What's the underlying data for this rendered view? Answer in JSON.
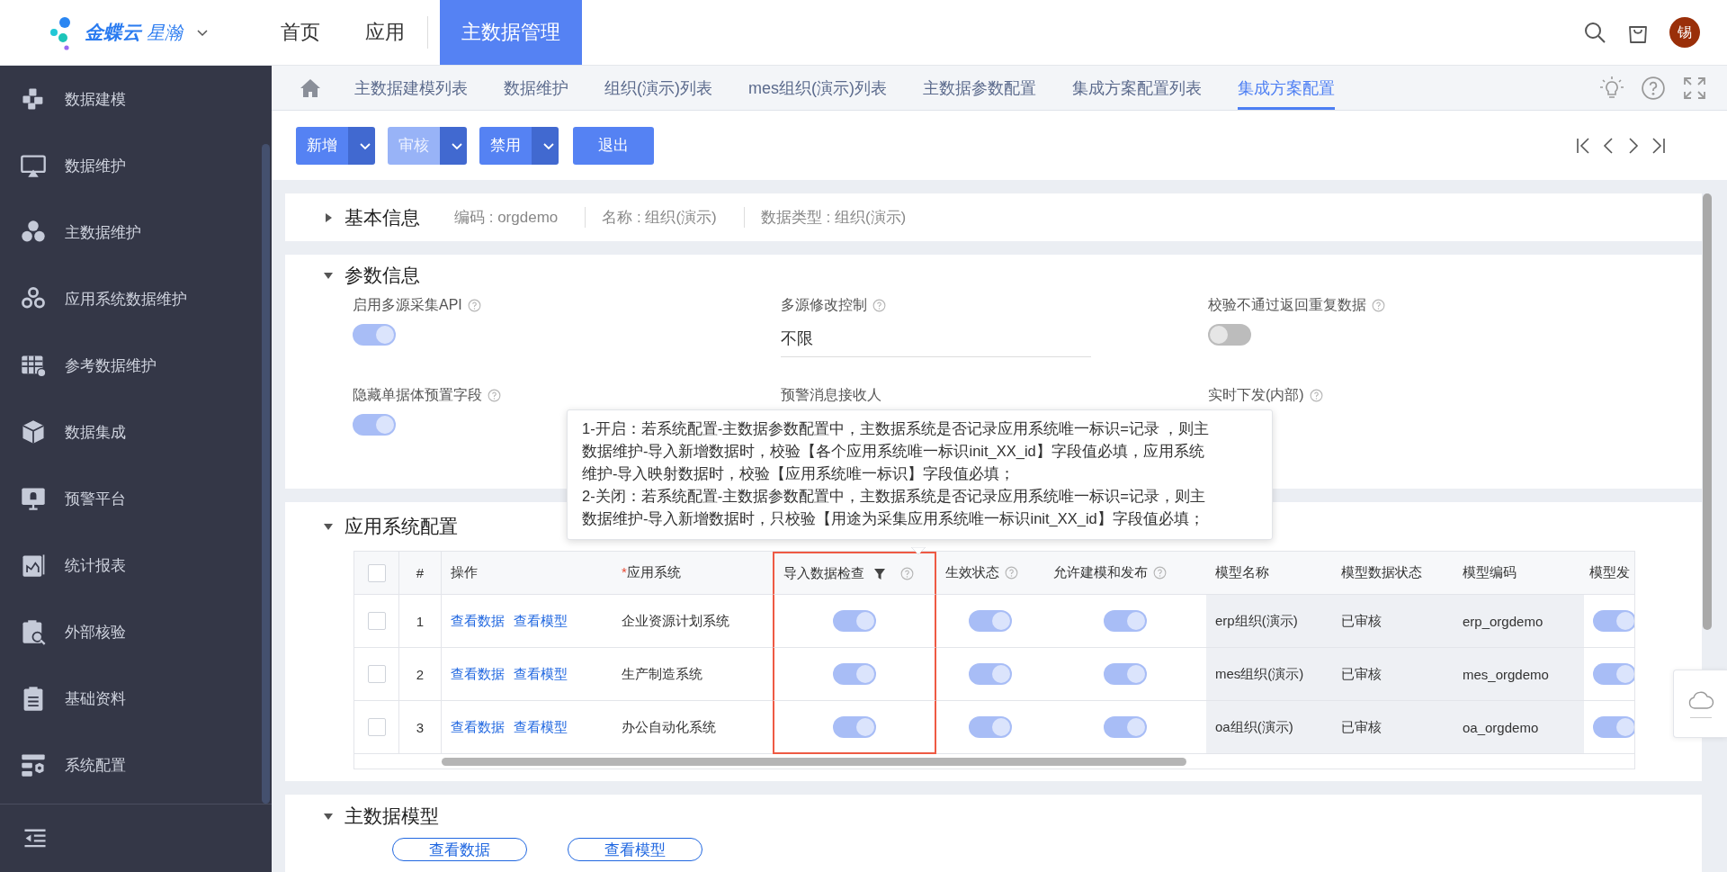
{
  "header": {
    "logo": {
      "brand": "金蝶云",
      "product": "星瀚"
    },
    "nav": [
      {
        "label": "首页",
        "selected": false
      },
      {
        "label": "应用",
        "selected": false
      },
      {
        "label": "主数据管理",
        "selected": true
      }
    ],
    "avatar": "锡"
  },
  "sidebar": {
    "items": [
      {
        "label": "数据建模"
      },
      {
        "label": "数据维护"
      },
      {
        "label": "主数据维护"
      },
      {
        "label": "应用系统数据维护"
      },
      {
        "label": "参考数据维护"
      },
      {
        "label": "数据集成"
      },
      {
        "label": "预警平台"
      },
      {
        "label": "统计报表"
      },
      {
        "label": "外部核验"
      },
      {
        "label": "基础资料"
      },
      {
        "label": "系统配置"
      }
    ]
  },
  "tabs": [
    {
      "label": "主数据建模列表",
      "selected": false
    },
    {
      "label": "数据维护",
      "selected": false
    },
    {
      "label": "组织(演示)列表",
      "selected": false
    },
    {
      "label": "mes组织(演示)列表",
      "selected": false
    },
    {
      "label": "主数据参数配置",
      "selected": false
    },
    {
      "label": "集成方案配置列表",
      "selected": false
    },
    {
      "label": "集成方案配置",
      "selected": true
    }
  ],
  "toolbar": {
    "buttons": [
      {
        "label": "新增",
        "kind": "split",
        "disabled": false
      },
      {
        "label": "审核",
        "kind": "split",
        "disabled": true
      },
      {
        "label": "禁用",
        "kind": "split",
        "disabled": false
      },
      {
        "label": "退出",
        "kind": "plain",
        "disabled": false
      }
    ]
  },
  "basic_info": {
    "title": "基本信息",
    "expanded": false,
    "fields": [
      "编码 : orgdemo",
      "名称 : 组织(演示)",
      "数据类型 : 组织(演示)"
    ]
  },
  "params": {
    "title": "参数信息",
    "expanded": true,
    "fields": [
      {
        "label": "启用多源采集API",
        "help": true,
        "kind": "toggle",
        "on": true
      },
      {
        "label": "多源修改控制",
        "help": true,
        "kind": "select",
        "value": "不限"
      },
      {
        "label": "校验不通过返回重复数据",
        "help": true,
        "kind": "toggle",
        "on": false
      },
      {
        "label": "隐藏单据体预置字段",
        "help": true,
        "kind": "toggle",
        "on": true
      },
      {
        "label": "预警消息接收人",
        "help": false,
        "kind": "covered"
      },
      {
        "label": "实时下发(内部)",
        "help": true,
        "kind": "covered"
      }
    ]
  },
  "tooltip": {
    "paragraphs": [
      "1-开启：若系统配置-主数据参数配置中，主数据系统是否记录应用系统唯一标识=记录 ，则主数据维护-导入新增数据时，校验【各个应用系统唯一标识init_XX_id】字段值必填，应用系统维护-导入映射数据时，校验【应用系统唯一标识】字段值必填；",
      "2-关闭：若系统配置-主数据参数配置中，主数据系统是否记录应用系统唯一标识=记录，则主数据维护-导入新增数据时，只校验【用途为采集应用系统唯一标识init_XX_id】字段值必填；"
    ]
  },
  "app_systems": {
    "title": "应用系统配置",
    "expanded": true,
    "select_all_checked": false,
    "columns": [
      {
        "label": "#",
        "filter": false,
        "help": false,
        "highlighted": false
      },
      {
        "label": "操作",
        "filter": false,
        "help": false,
        "highlighted": false
      },
      {
        "label": "应用系统",
        "marker": "*",
        "filter": false,
        "help": false,
        "highlighted": false
      },
      {
        "label": "导入数据检查",
        "filter": true,
        "help": true,
        "highlighted": true
      },
      {
        "label": "生效状态",
        "filter": false,
        "help": true,
        "highlighted": false
      },
      {
        "label": "允许建模和发布",
        "filter": false,
        "help": true,
        "highlighted": false
      },
      {
        "label": "模型名称",
        "filter": false,
        "help": false,
        "highlighted": false
      },
      {
        "label": "模型数据状态",
        "filter": false,
        "help": false,
        "highlighted": false
      },
      {
        "label": "模型编码",
        "filter": false,
        "help": false,
        "highlighted": false
      },
      {
        "label": "模型发",
        "filter": false,
        "help": false,
        "highlighted": false
      }
    ],
    "rows": [
      {
        "checked": false,
        "index": "1",
        "actions": [
          "查看数据",
          "查看模型"
        ],
        "system": "企业资源计划系统",
        "import_check": true,
        "effective": true,
        "allow_model": true,
        "model_name": "erp组织(演示)",
        "model_status": "已审核",
        "model_code": "erp_orgdemo",
        "column_11": true
      },
      {
        "checked": false,
        "index": "2",
        "actions": [
          "查看数据",
          "查看模型"
        ],
        "system": "生产制造系统",
        "import_check": true,
        "effective": true,
        "allow_model": true,
        "model_name": "mes组织(演示)",
        "model_status": "已审核",
        "model_code": "mes_orgdemo",
        "column_11": true
      },
      {
        "checked": false,
        "index": "3",
        "actions": [
          "查看数据",
          "查看模型"
        ],
        "system": "办公自动化系统",
        "import_check": true,
        "effective": true,
        "allow_model": true,
        "model_name": "oa组织(演示)",
        "model_status": "已审核",
        "model_code": "oa_orgdemo",
        "column_11": true
      }
    ]
  },
  "master_model": {
    "title": "主数据模型",
    "expanded": true,
    "buttons": [
      "查看数据",
      "查看模型"
    ]
  }
}
